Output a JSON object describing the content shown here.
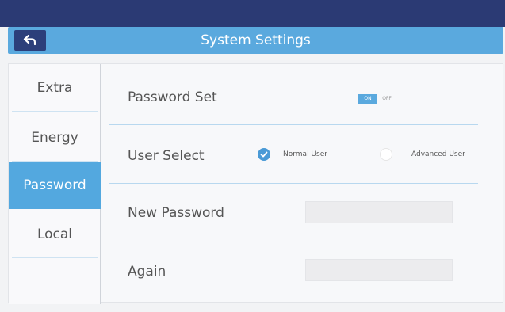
{
  "header": {
    "title": "System Settings",
    "back_icon": "back-arrow-icon"
  },
  "sidebar": {
    "items": [
      {
        "label": "Extra",
        "active": false
      },
      {
        "label": "Energy",
        "active": false
      },
      {
        "label": "Password",
        "active": true
      },
      {
        "label": "Local",
        "active": false
      }
    ]
  },
  "settings": {
    "password_set": {
      "label": "Password Set",
      "toggle_on_label": "ON",
      "toggle_off_label": "OFF",
      "state": "ON"
    },
    "user_select": {
      "label": "User Select",
      "options": [
        {
          "label": "Normal User",
          "selected": true
        },
        {
          "label": "Advanced User",
          "selected": false
        }
      ]
    },
    "new_password": {
      "label": "New Password",
      "value": ""
    },
    "again": {
      "label": "Again",
      "value": ""
    }
  },
  "colors": {
    "accent": "#5aa9de",
    "top_bar": "#2b3a74",
    "back_button": "#2c3f7a"
  }
}
